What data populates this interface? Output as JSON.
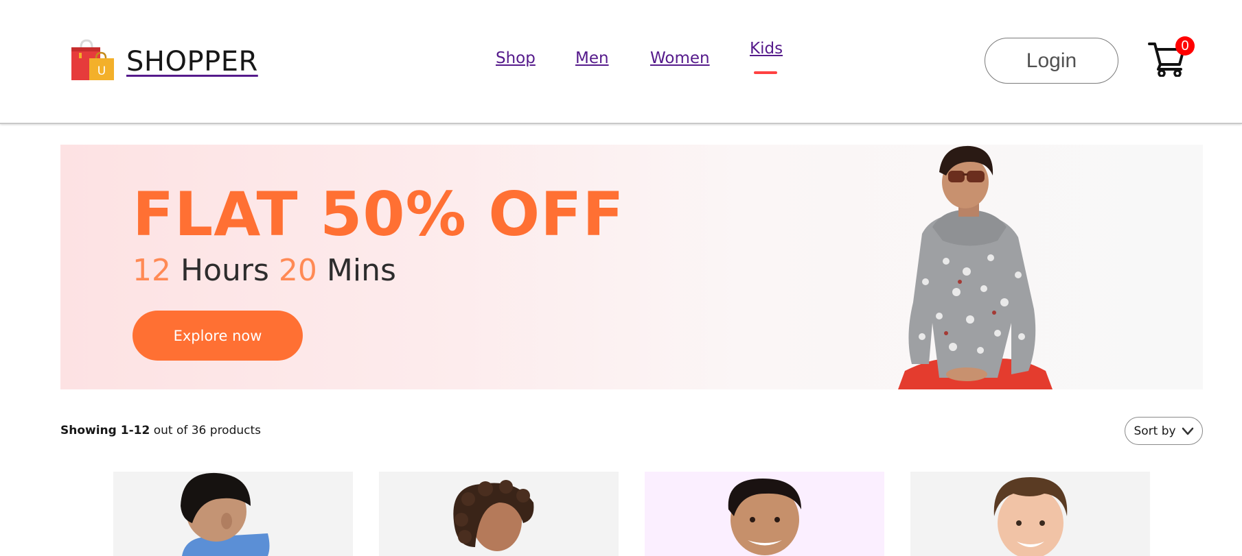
{
  "brand": {
    "name": "SHOPPER"
  },
  "nav": {
    "items": [
      {
        "label": "Shop"
      },
      {
        "label": "Men"
      },
      {
        "label": "Women"
      },
      {
        "label": "Kids",
        "active": true
      }
    ]
  },
  "header": {
    "login_label": "Login",
    "cart_count": "0"
  },
  "banner": {
    "headline": "FLAT 50% OFF",
    "timer_hours": "12",
    "timer_hours_label": "Hours",
    "timer_mins": "20",
    "timer_mins_label": "Mins",
    "cta_label": "Explore now"
  },
  "listing": {
    "showing_range": "Showing 1-12",
    "showing_rest": "out of 36 products",
    "sort_label": "Sort by"
  },
  "products": [
    {
      "bg": "#f3f3f3",
      "name_visible": false
    },
    {
      "bg": "#f3f3f3",
      "name_visible": false
    },
    {
      "bg": "#fbefff",
      "name_visible": false
    },
    {
      "bg": "#f3f3f3",
      "name_visible": false
    }
  ],
  "colors": {
    "accent": "#ff7033",
    "nav_link": "#551a8b",
    "active_indicator": "#ff4141",
    "cart_badge": "#ff0000"
  },
  "icons": [
    "shopping-bag-logo-icon",
    "cart-icon",
    "chevron-down-icon"
  ]
}
